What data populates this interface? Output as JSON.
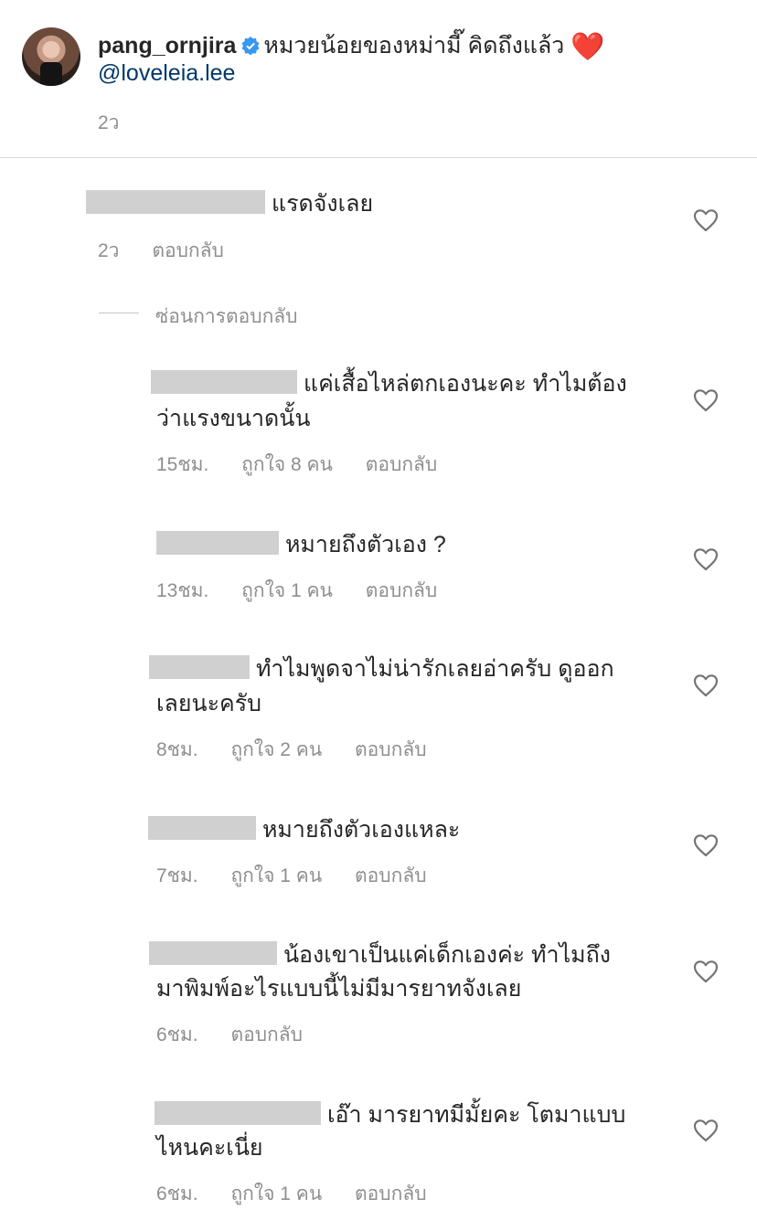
{
  "caption": {
    "username": "pang_ornjira",
    "text": "หมวยน้อยของหม่ามี๊ คิดถึงแล้ว",
    "emoji": "❤️",
    "mention": "@loveleia.lee",
    "time": "2ว"
  },
  "comments": [
    {
      "text": "แรดจังเลย",
      "time": "2ว",
      "likes": "",
      "reply": "ตอบกลับ"
    },
    {
      "text_line1": "แค่เสื้อไหล่ตกเองนะคะ ทำไมต้อง",
      "text_line2": "ว่าแรงขนาดนั้น",
      "time": "15ชม.",
      "likes": "ถูกใจ 8 คน",
      "reply": "ตอบกลับ"
    },
    {
      "text": "หมายถึงตัวเอง ?",
      "time": "13ชม.",
      "likes": "ถูกใจ 1 คน",
      "reply": "ตอบกลับ"
    },
    {
      "text_line1": "ทำไมพูดจาไม่น่ารักเลยอ่าครับ  ดูออก",
      "text_line2": "เลยนะครับ",
      "time": "8ชม.",
      "likes": "ถูกใจ 2 คน",
      "reply": "ตอบกลับ"
    },
    {
      "text": "หมายถึงตัวเองแหละ",
      "time": "7ชม.",
      "likes": "ถูกใจ 1 คน",
      "reply": "ตอบกลับ"
    },
    {
      "text_line1": "น้องเขาเป็นแค่เด็กเองค่ะ ทำไมถึง",
      "text_line2": "มาพิมพ์อะไรแบบนี้ไม่มีมารยาทจังเลย",
      "time": "6ชม.",
      "likes": "",
      "reply": "ตอบกลับ"
    },
    {
      "text_line1": "เอ๊า มารยาทมีมั้ยคะ โตมาแบบ",
      "text_line2": "ไหนคะเนี่ย",
      "time": "6ชม.",
      "likes": "ถูกใจ 1 คน",
      "reply": "ตอบกลับ"
    }
  ],
  "hide_replies": "ซ่อนการตอบกลับ",
  "colors": {
    "heart": "#e0262c",
    "verified": "#3897f0",
    "mention": "#00376b",
    "muted": "#8e8e8e"
  },
  "icons": {
    "like": "heart-outline-icon",
    "verified": "verified-badge-icon"
  }
}
